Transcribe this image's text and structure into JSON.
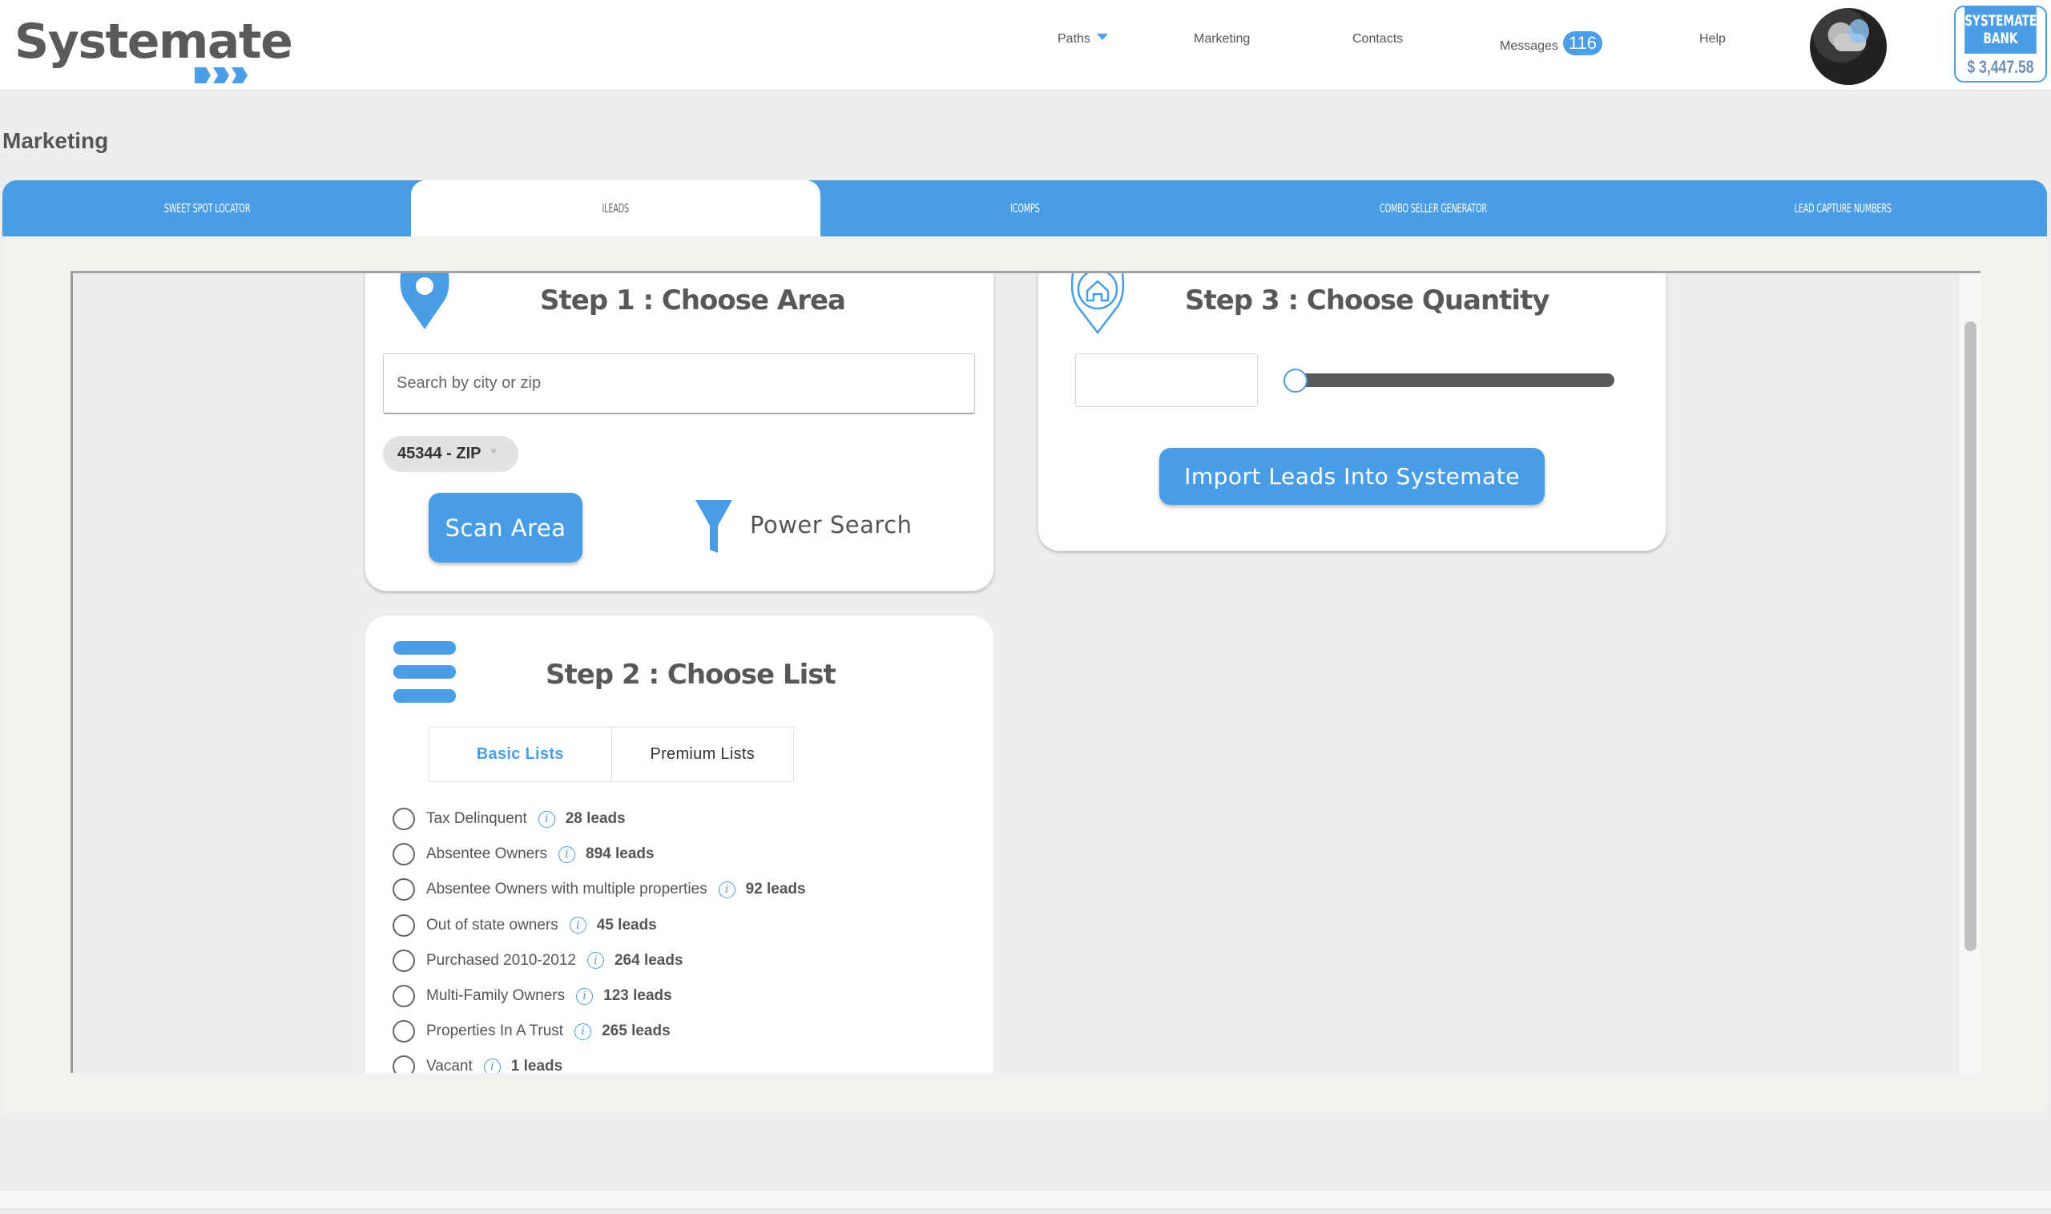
{
  "header": {
    "logo_text": "Systemate",
    "nav": [
      {
        "label": "Paths",
        "has_dropdown": true
      },
      {
        "label": "Marketing"
      },
      {
        "label": "Contacts"
      },
      {
        "label": "Messages",
        "badge": "116"
      },
      {
        "label": "Help"
      }
    ],
    "bank": {
      "title_line1": "SYSTEMATE",
      "title_line2": "BANK",
      "balance": "$ 3,447.58"
    }
  },
  "page": {
    "title": "Marketing"
  },
  "tabs": [
    {
      "label": "Sweet Spot Locator",
      "active": false
    },
    {
      "label": "iLeads",
      "active": true
    },
    {
      "label": "iComps",
      "active": false
    },
    {
      "label": "Combo Seller Generator",
      "active": false
    },
    {
      "label": "Lead Capture Numbers",
      "active": false
    }
  ],
  "step1": {
    "title": "Step 1 : Choose Area",
    "search_placeholder": "Search by city or zip",
    "search_value": "",
    "chip": {
      "label": "45344 - ZIP",
      "remove": "*"
    },
    "scan_button": "Scan Area",
    "power_search": "Power Search"
  },
  "step2": {
    "title": "Step 2 : Choose List",
    "list_tabs": [
      {
        "label": "Basic Lists",
        "active": true
      },
      {
        "label": "Premium Lists",
        "active": false
      }
    ],
    "items": [
      {
        "label": "Tax Delinquent",
        "leads": "28 leads"
      },
      {
        "label": "Absentee Owners",
        "leads": "894 leads"
      },
      {
        "label": "Absentee Owners with multiple properties",
        "leads": "92 leads"
      },
      {
        "label": "Out of state owners",
        "leads": "45 leads"
      },
      {
        "label": "Purchased 2010-2012",
        "leads": "264 leads"
      },
      {
        "label": "Multi-Family Owners",
        "leads": "123 leads"
      },
      {
        "label": "Properties In A Trust",
        "leads": "265 leads"
      },
      {
        "label": "Vacant",
        "leads": "1 leads"
      }
    ],
    "info_glyph": "i"
  },
  "step3": {
    "title": "Step 3 : Choose Quantity",
    "quantity_value": "",
    "slider_fraction": 0,
    "import_button": "Import Leads Into Systemate"
  },
  "colors": {
    "accent": "#489DE6",
    "text": "#555555",
    "panel": "#F2F1EE",
    "page_bg": "#ECEDEF"
  }
}
